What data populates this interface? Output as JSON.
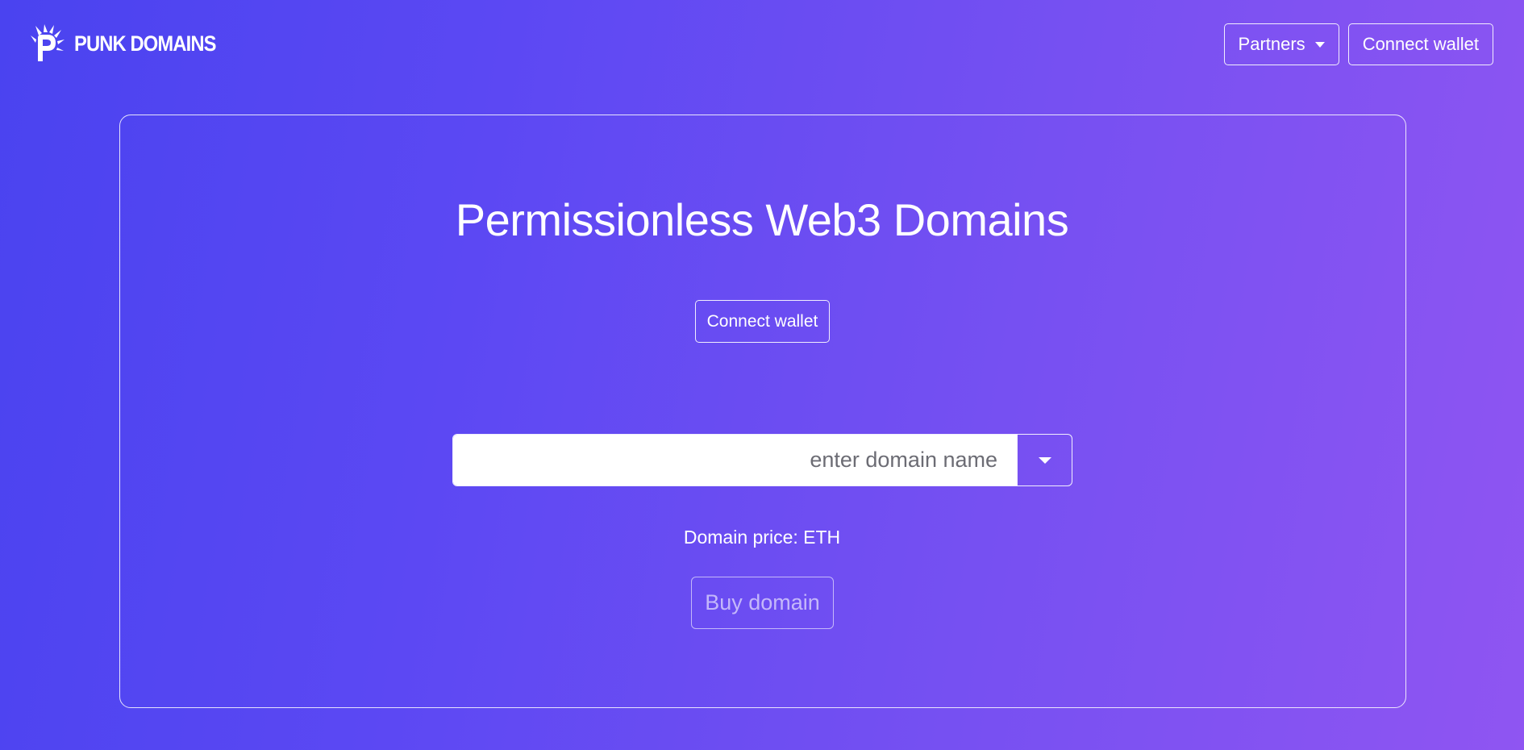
{
  "brand": {
    "name": "PUNK DOMAINS",
    "logo_icon": "punk-domains-logo-icon"
  },
  "nav": {
    "partners_label": "Partners",
    "connect_wallet_label": "Connect wallet"
  },
  "hero": {
    "title": "Permissionless Web3 Domains",
    "connect_wallet_label": "Connect wallet"
  },
  "domain_form": {
    "input_value": "",
    "input_placeholder": "enter domain name",
    "tld_dropdown_icon": "caret-down-icon",
    "price_text": "Domain price: ETH",
    "buy_label": "Buy domain",
    "buy_disabled": true
  },
  "colors": {
    "gradient_start": "#4a43f0",
    "gradient_end": "#8f55f2",
    "text": "#ffffff",
    "input_bg": "#ffffff",
    "placeholder": "#6c6c74"
  }
}
